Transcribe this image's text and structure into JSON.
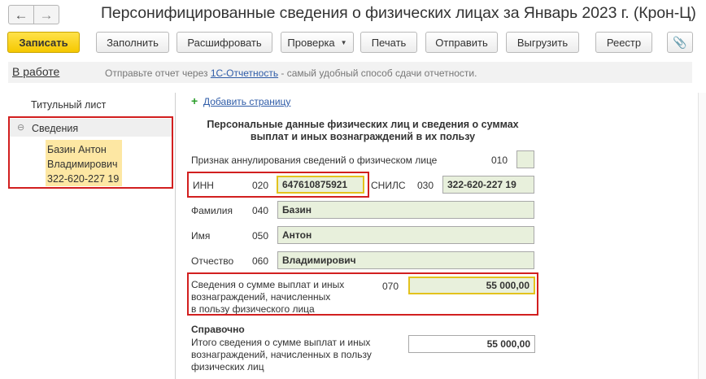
{
  "window": {
    "title": "Персонифицированные сведения о физических лицах за Январь 2023 г. (Крон-Ц)"
  },
  "icons": {
    "back": "←",
    "forward": "→",
    "attach": "📎",
    "collapse": "⊖",
    "add": "+",
    "dropdown": "▼"
  },
  "toolbar": {
    "save_label": "Записать",
    "fill_label": "Заполнить",
    "decode_label": "Расшифровать",
    "check_label": "Проверка",
    "print_label": "Печать",
    "send_label": "Отправить",
    "export_label": "Выгрузить",
    "registry_label": "Реестр"
  },
  "status": {
    "state_link": "В работе",
    "message_prefix": "Отправьте отчет через ",
    "message_link": "1С-Отчетность",
    "message_suffix": " - самый удобный способ сдачи отчетности."
  },
  "sidebar": {
    "title_page": "Титульный лист",
    "section_label": "Сведения",
    "person_line1": "Базин Антон",
    "person_line2": "Владимирович",
    "person_line3": "322-620-227 19"
  },
  "form": {
    "add_page_link": "Добавить страницу",
    "section_title_line1": "Персональные данные физических лиц и сведения о суммах",
    "section_title_line2": "выплат и иных вознаграждений в их пользу",
    "annul_label": "Признак аннулирования сведений о физическом лице",
    "annul_code": "010",
    "inn_label": "ИНН",
    "inn_code": "020",
    "inn_value": "647610875921",
    "snils_label": "СНИЛС",
    "snils_code": "030",
    "snils_value": "322-620-227 19",
    "lastname_label": "Фамилия",
    "lastname_code": "040",
    "lastname_value": "Базин",
    "firstname_label": "Имя",
    "firstname_code": "050",
    "firstname_value": "Антон",
    "patronymic_label": "Отчество",
    "patronymic_code": "060",
    "patronymic_value": "Владимирович",
    "payments_label_line1": "Сведения о сумме выплат и иных",
    "payments_label_line2": "вознаграждений, начисленных",
    "payments_label_line3": "в пользу физического лица",
    "payments_code": "070",
    "payments_value": "55 000,00",
    "reference_title": "Справочно",
    "total_label_line1": "Итого сведения о сумме выплат и иных",
    "total_label_line2": "вознаграждений, начисленных в пользу",
    "total_label_line3": "физических лиц",
    "total_value": "55 000,00"
  },
  "colors": {
    "highlight_red": "#d21f1f",
    "primary_button": "#f5c800",
    "field_green": "#e8f0dc",
    "selected_person": "#fde7a3",
    "link_blue": "#2f5ca8"
  }
}
